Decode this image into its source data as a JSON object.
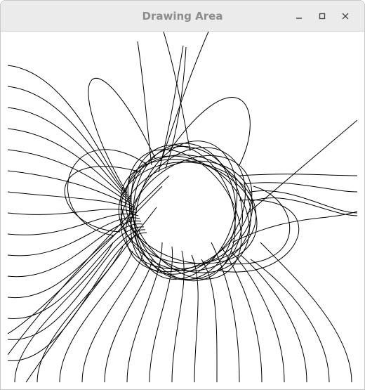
{
  "window": {
    "title": "Drawing Area",
    "controls": [
      {
        "name": "minimize",
        "icon": "minimize-icon"
      },
      {
        "name": "maximize",
        "icon": "maximize-icon"
      },
      {
        "name": "close",
        "icon": "close-icon"
      }
    ]
  },
  "canvas": {
    "background": "#ffffff",
    "stroke": "#000000"
  }
}
